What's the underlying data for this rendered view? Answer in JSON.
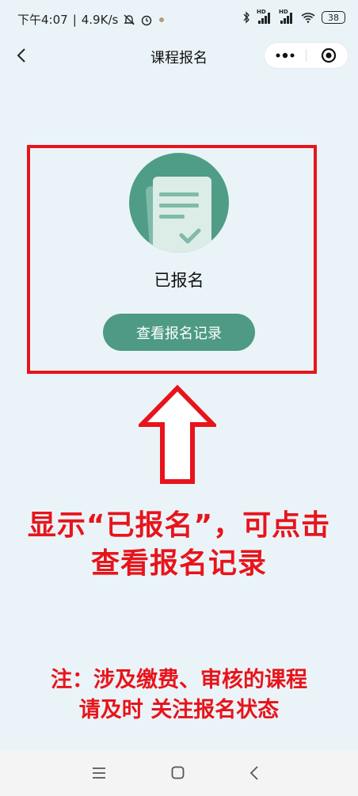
{
  "status_bar": {
    "time": "下午4:07",
    "net_speed": "4.9K/s",
    "battery": "38",
    "hd1": "HD",
    "hd2": "HD"
  },
  "navbar": {
    "title": "课程报名",
    "icons": [
      "back-icon",
      "more-icon",
      "target-icon"
    ]
  },
  "registration": {
    "status_label": "已报名",
    "view_records_button": "查看报名记录",
    "icon": "document-check-icon"
  },
  "annotation": {
    "line1": "显示“已报名”，可点击",
    "line2": "查看报名记录",
    "note_line1": "注：涉及缴费、审核的课程",
    "note_line2": "请及时 关注报名状态"
  },
  "colors": {
    "accent": "#4e9a84",
    "highlight": "#e8141b",
    "background": "#eaf4f8"
  },
  "system_nav": {
    "icons": [
      "menu-icon",
      "home-icon",
      "back-icon"
    ]
  }
}
